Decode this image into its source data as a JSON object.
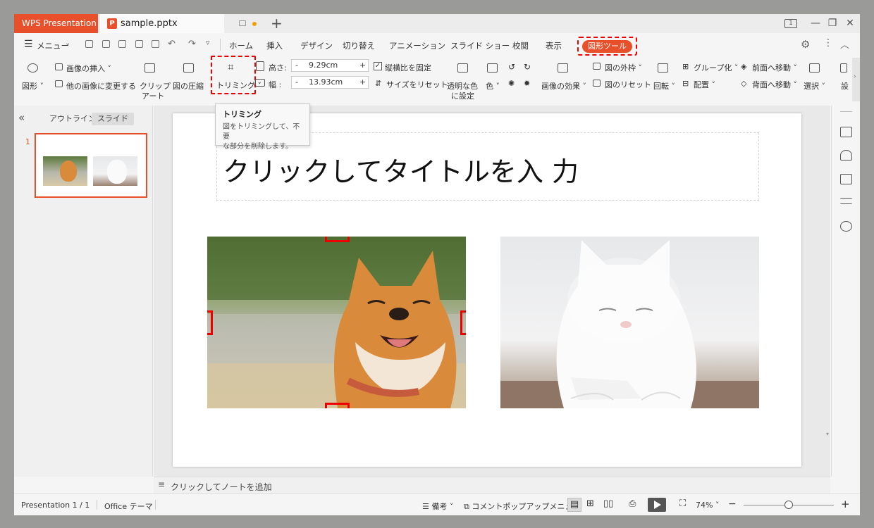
{
  "window": {
    "app_tab": "WPS Presentation",
    "file_tab": "sample.pptx",
    "new_tab": "+",
    "page_indicator": "1"
  },
  "menu": {
    "menu_label": "メニュー",
    "tabs": [
      "ホーム",
      "挿入",
      "デザイン",
      "切り替え",
      "アニメーション",
      "スライド ショー",
      "校閲",
      "表示"
    ],
    "active_tool_tab": "図形ツール"
  },
  "ribbon": {
    "shape": "図形",
    "insert_image": "画像の挿入",
    "change_image": "他の画像に変更する",
    "clip_art_1": "クリップ",
    "clip_art_2": "アート",
    "compress": "図の圧縮",
    "trim": "トリミング",
    "height_label": "高さ:",
    "height_value": "9.29cm",
    "width_label": "幅 :",
    "width_value": "13.93cm",
    "spin_minus": "-",
    "spin_plus": "+",
    "lock_ratio": "縦横比を固定",
    "reset_size": "サイズをリセット",
    "transparent_1": "透明な色",
    "transparent_2": "に設定",
    "color": "色",
    "image_effect": "画像の効果",
    "outline": "図の外枠",
    "reset_picture": "図のリセット",
    "rotate": "回転",
    "group": "グループ化",
    "arrange": "配置",
    "bring_forward": "前面へ移動",
    "send_backward": "背面へ移動",
    "select": "選択",
    "settings_cut": "設"
  },
  "tooltip": {
    "title": "トリミング",
    "line1": "図をトリミングして、不要",
    "line2": "な部分を削除します。"
  },
  "left_pane": {
    "collapse": "«",
    "tab_outline": "アウトライン",
    "tab_slide": "スライド",
    "slide_number": "1"
  },
  "slide": {
    "title_placeholder": "クリックしてタイトルを入 力"
  },
  "notes": {
    "placeholder": "クリックしてノートを追加"
  },
  "status": {
    "slide_count": "Presentation 1 / 1",
    "theme": "Office テーマ",
    "notes_btn": "備考",
    "comment_btn": "コメントポップアップメニュー",
    "zoom": "74%",
    "zoom_minus": "−",
    "zoom_plus": "+",
    "zoom_level": 0.5
  },
  "colors": {
    "accent": "#e8502c",
    "highlight": "#e00000"
  }
}
